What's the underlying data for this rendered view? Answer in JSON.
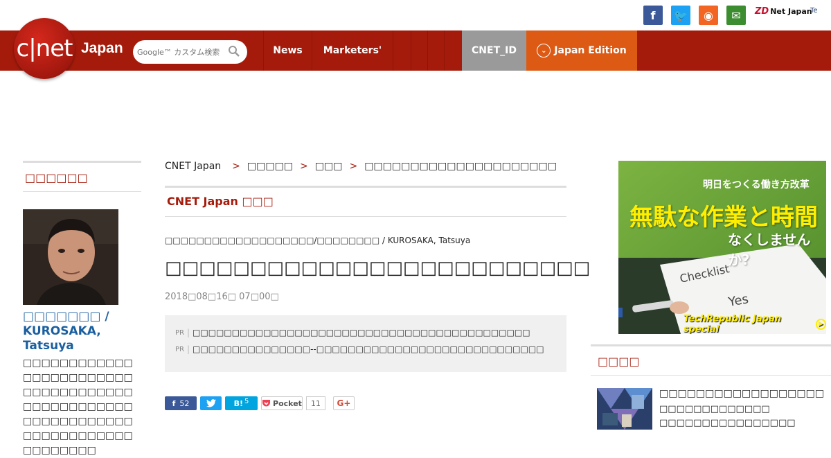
{
  "header": {
    "social": [
      {
        "name": "facebook",
        "glyph": "f",
        "color": "#3b5998"
      },
      {
        "name": "twitter",
        "glyph": "🐦",
        "color": "#1da1f2"
      },
      {
        "name": "rss",
        "glyph": "◉",
        "color": "#f26522"
      },
      {
        "name": "mail",
        "glyph": "✉",
        "color": "#3c8d2f"
      }
    ],
    "zdnet_mark": "ZD",
    "zdnet_label": "Net Japan",
    "tr_label": "Te"
  },
  "nav": {
    "logo_text": "c|net",
    "logo_sub": "Japan",
    "search_placeholder": "Google™ カスタム検索",
    "items": [
      "News",
      "Marketers'"
    ],
    "cnet_id": "CNET_ID",
    "edition": "Japan Edition"
  },
  "sidebar": {
    "section_title": "□□□□□□",
    "author_name": "□□□□□□□ / KUROSAKA, Tatsuya",
    "author_bio": "□□□□□□□□□□□□□□□□□□□□□□□□□□□□□□□□□□□□□□□□□□□□□□□□□□□□□□□□□□□□□□□□□□□□□□□□□□□□□□□□"
  },
  "breadcrumb": {
    "items": [
      "CNET Japan",
      "□□□□□",
      "□□□",
      "□□□□□□□□□□□□□□□□□□□□□"
    ],
    "sep": ">"
  },
  "article": {
    "section": "CNET Japan □□□",
    "byline": "□□□□□□□□□□□□□□□□□□□/□□□□□□□□ / KUROSAKA, Tatsuya",
    "headline": "□□□□□□□□□□□□□□□□□□□□□□□□□",
    "date": "2018□08□16□ 07□00□",
    "pr_label": "PR",
    "pr_links": [
      "□□□□□□□□□□□□□□□□□□□□□□□□□□□□□□□□□□□□□□□□□□□",
      "□□□□□□□□□□□□□□□--□□□□□□□□□□□□□□□□□□□□□□□□□□□□□"
    ],
    "share": {
      "fb_count": "52",
      "hb_label": "B!",
      "hb_count": "5",
      "pocket_label": "Pocket",
      "pocket_count": "11",
      "gplus_label": "G+"
    }
  },
  "right": {
    "ad": {
      "tagline": "明日をつくる働き方改革",
      "head1": "無駄な作業と時間",
      "head2": "なくしませんか?",
      "note1": "Checklist",
      "note2": "Yes",
      "brand": "TechRepublic Japan special"
    },
    "section_title": "□□□□",
    "item_title": "□□□□□□□□□□□□□□□□□□",
    "item_sub1": "□□□□□□□□□□□□□",
    "item_sub2": "□□□□□□□□□□□□□□□□"
  }
}
